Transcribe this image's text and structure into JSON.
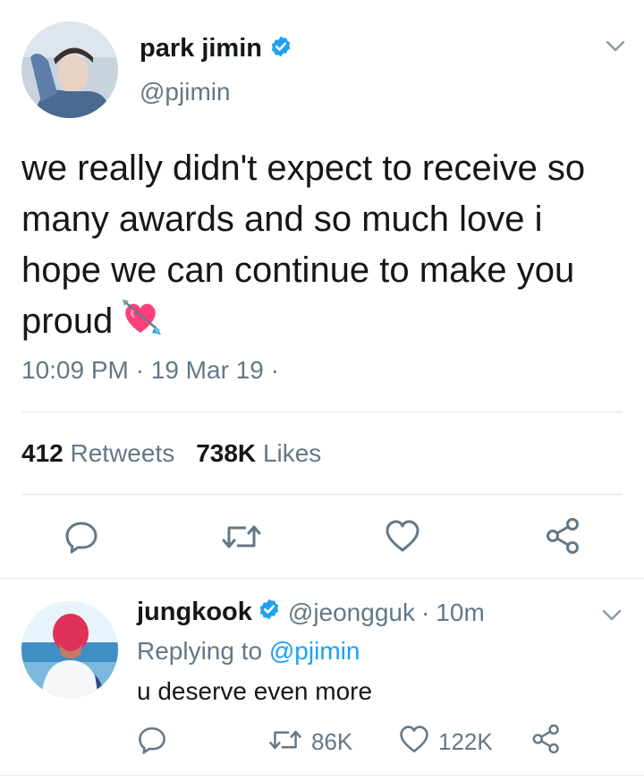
{
  "main_tweet": {
    "display_name": "park jimin",
    "handle": "@pjimin",
    "verified": true,
    "text": "we really didn't expect to receive so many awards and so much love i hope we can continue to make you proud",
    "emoji": "heart-with-arrow",
    "time": "10:09 PM",
    "date": "19 Mar 19",
    "separator": "·",
    "retweets_count": "412",
    "retweets_label": "Retweets",
    "likes_count": "738K",
    "likes_label": "Likes",
    "actions": [
      "reply-icon",
      "retweet-icon",
      "like-icon",
      "share-icon"
    ]
  },
  "reply": {
    "display_name": "jungkook",
    "handle": "@jeongguk",
    "verified": true,
    "separator": "·",
    "age": "10m",
    "replying_prefix": "Replying to",
    "replying_to": "@pjimin",
    "text": "u deserve even more",
    "retweets": "86K",
    "likes": "122K"
  },
  "colors": {
    "accent": "#1da1f2",
    "text": "#14171a",
    "muted": "#657786",
    "heart_emoji": "#ff3f7a"
  }
}
